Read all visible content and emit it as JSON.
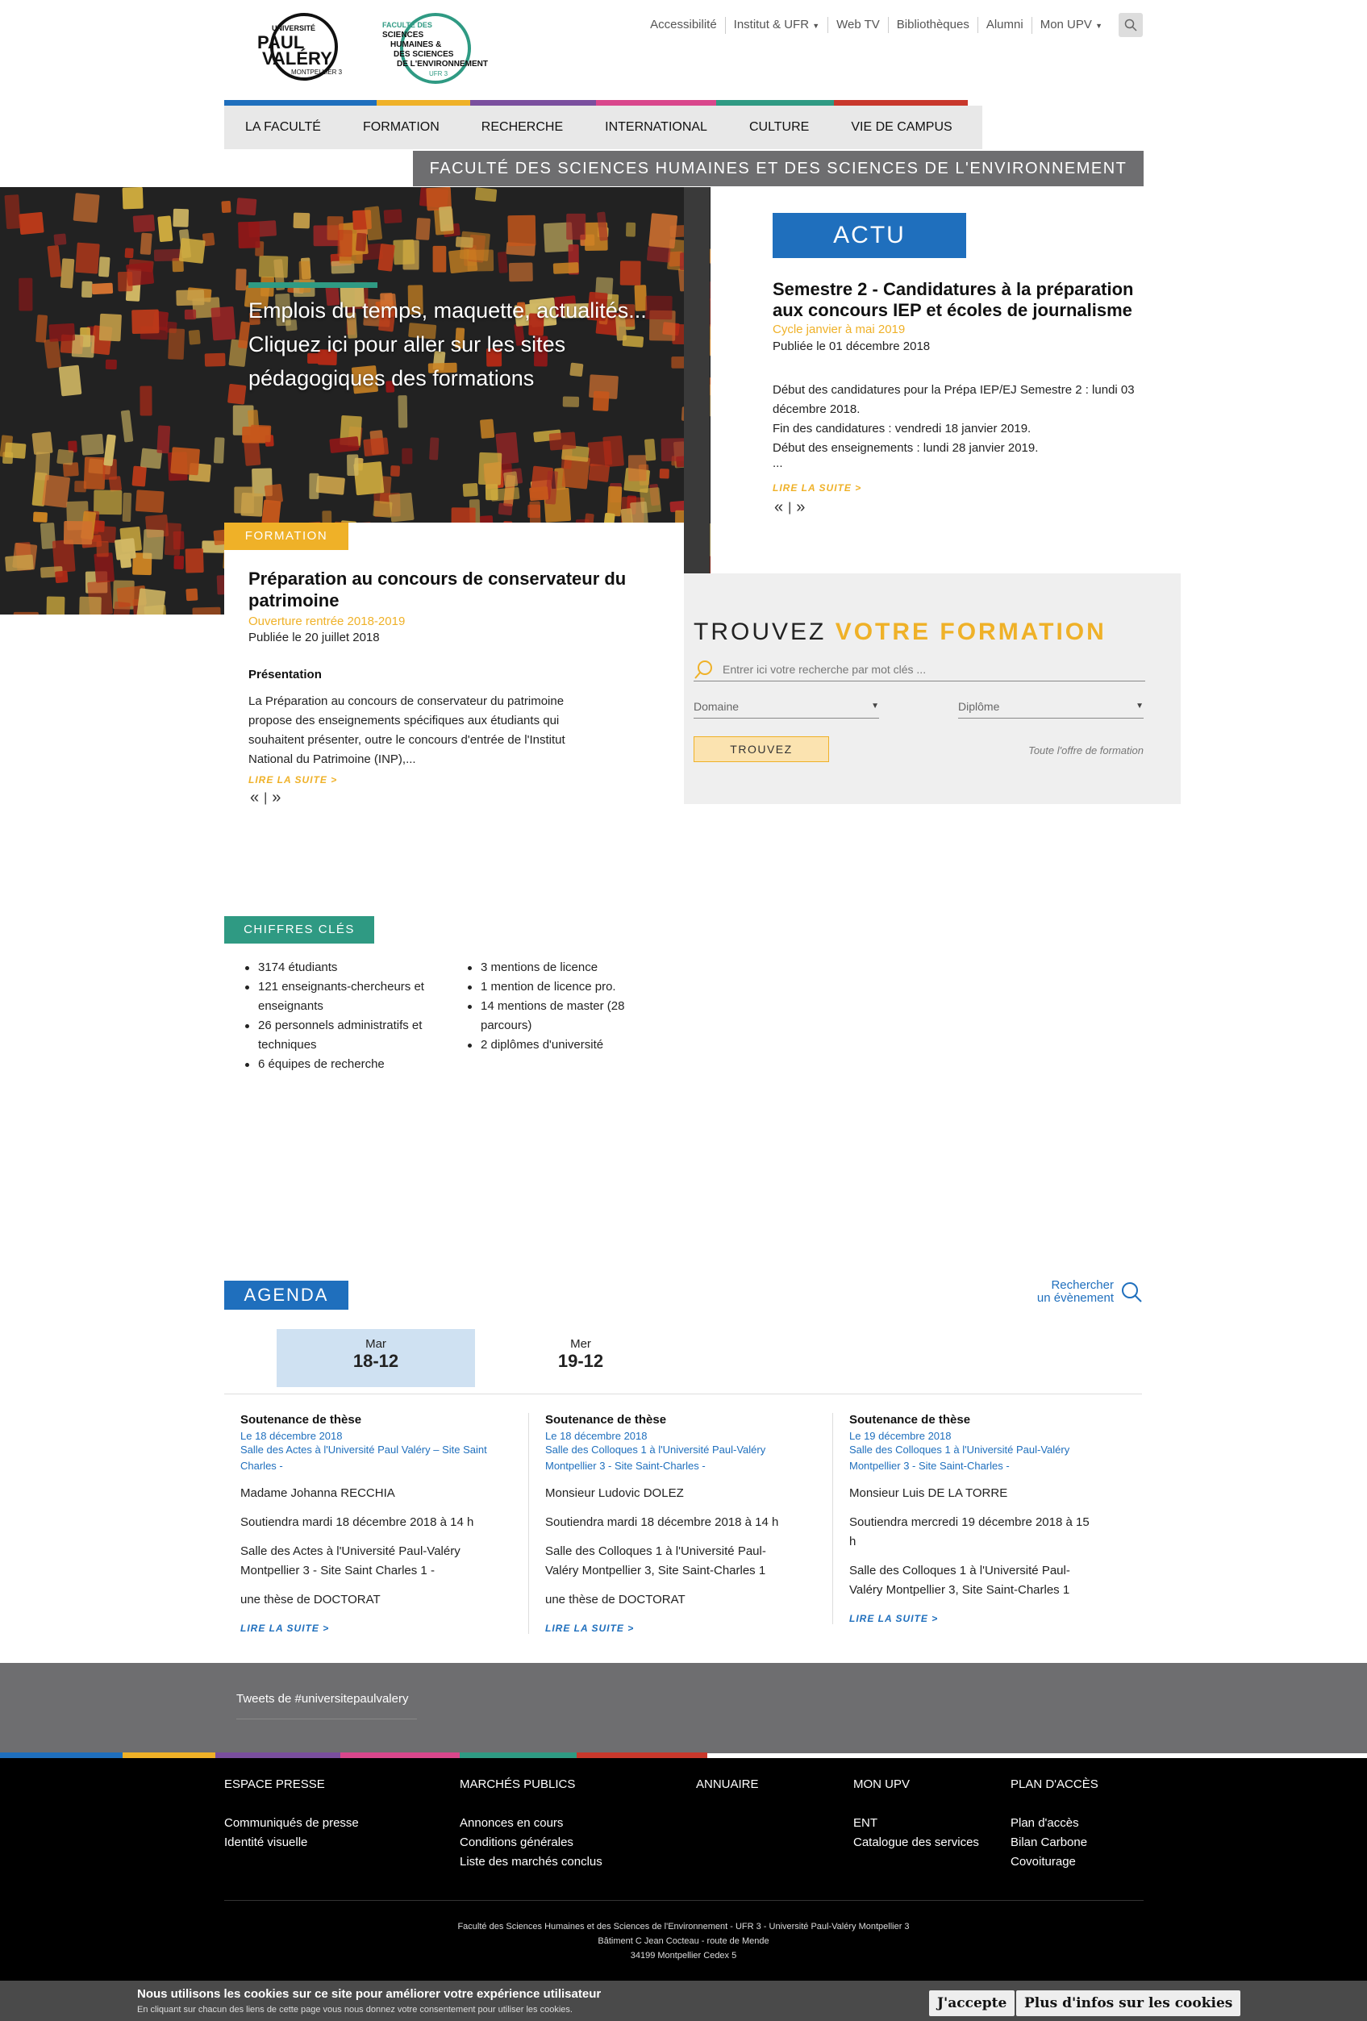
{
  "header": {
    "logo_upv_lines": [
      "UNIVERSITÉ",
      "PAUL",
      "VALÉRY",
      "MONTPELLIER 3"
    ],
    "logo_ufr_lines": [
      "FACULTÉ DES",
      "SCIENCES",
      "HUMAINES &",
      "DES SCIENCES",
      "DE L'ENVIRONNEMENT",
      "UFR 3"
    ],
    "top_links": [
      "Accessibilité",
      "Institut & UFR",
      "Web TV",
      "Bibliothèques",
      "Alumni",
      "Mon UPV"
    ],
    "main_nav": [
      "LA FACULTÉ",
      "FORMATION",
      "RECHERCHE",
      "INTERNATIONAL",
      "CULTURE",
      "VIE DE CAMPUS"
    ],
    "faculty_banner": "FACULTÉ DES SCIENCES HUMAINES ET DES SCIENCES DE L'ENVIRONNEMENT",
    "nav_colors": [
      "#1f6fbd",
      "#efb128",
      "#7a4f9e",
      "#d9478c",
      "#2f9a83",
      "#c8382c"
    ]
  },
  "hero": {
    "text_lines": [
      "Emplois du temps, maquette, actualités...",
      "Cliquez ici pour aller sur les sites",
      "pédagogiques des formations"
    ]
  },
  "formation": {
    "tag": "FORMATION",
    "title": "Préparation au concours de conservateur du patrimoine",
    "subtitle": "Ouverture rentrée 2018-2019",
    "date": "Publiée le 20 juillet 2018",
    "heading": "Présentation",
    "body": "La Préparation au concours de conservateur du patrimoine propose des enseignements spécifiques aux étudiants qui souhaitent présenter, outre le concours d'entrée de l'Institut National du Patrimoine (INP),...",
    "read_more": "LIRE LA SUITE  >"
  },
  "actu": {
    "tag": "ACTU",
    "title": "Semestre 2 - Candidatures à la préparation aux concours IEP et écoles de journalisme",
    "subtitle": "Cycle janvier à mai 2019",
    "date": "Publiée le 01 décembre 2018",
    "body_lines": [
      "Début des candidatures pour la Prépa IEP/EJ Semestre 2 :  lundi 03 décembre 2018.",
      "Fin des candidatures : vendredi 18 janvier 2019.",
      "Début des enseignements : lundi 28 janvier 2019.",
      "..."
    ],
    "read_more": "LIRE LA SUITE  >"
  },
  "pager": {
    "prev": "«",
    "sep": "|",
    "next": "»"
  },
  "trouvez": {
    "title_plain": "TROUVEZ",
    "title_accent": "VOTRE FORMATION",
    "search_placeholder": "Entrer ici votre recherche par mot clés ...",
    "select_domaine": "Domaine",
    "select_diplome": "Diplôme",
    "button": "TROUVEZ",
    "all_link": "Toute l'offre de formation"
  },
  "chiffres": {
    "tag": "CHIFFRES CLÉS",
    "col1": [
      "3174 étudiants",
      "121 enseignants-chercheurs et enseignants",
      "26 personnels administratifs et techniques",
      "6 équipes de recherche"
    ],
    "col2": [
      "3 mentions de licence",
      "1 mention de licence pro.",
      "14 mentions de master (28 parcours)",
      "2 diplômes d'université"
    ]
  },
  "agenda": {
    "tag": "AGENDA",
    "search_line1": "Rechercher",
    "search_line2": "un évènement",
    "days": [
      {
        "name": "Mar",
        "num": "18-12"
      },
      {
        "name": "Mer",
        "num": "19-12"
      }
    ],
    "events": [
      {
        "title": "Soutenance de thèse",
        "date": "Le 18 décembre 2018",
        "place": "Salle des Actes à l'Université Paul Valéry – Site Saint Charles -",
        "p": [
          "Madame Johanna RECCHIA",
          "Soutiendra mardi 18 décembre 2018 à 14 h",
          "Salle des Actes à l'Université Paul-Valéry Montpellier 3  - Site Saint Charles 1 -",
          "une thèse de DOCTORAT"
        ],
        "read_more": "LIRE LA SUITE  >"
      },
      {
        "title": "Soutenance de thèse",
        "date": "Le 18 décembre 2018",
        "place": "Salle des Colloques 1 à l'Université Paul-Valéry Montpellier 3 - Site Saint-Charles -",
        "p": [
          "Monsieur Ludovic DOLEZ",
          "Soutiendra mardi 18 décembre 2018 à 14 h",
          "Salle des Colloques 1 à l'Université Paul-Valéry Montpellier 3, Site Saint-Charles 1",
          "une thèse de DOCTORAT"
        ],
        "read_more": "LIRE LA SUITE  >"
      },
      {
        "title": "Soutenance de thèse",
        "date": "Le 19 décembre 2018",
        "place": "Salle des Colloques 1 à l'Université Paul-Valéry Montpellier 3 - Site Saint-Charles -",
        "p": [
          "Monsieur Luis DE LA TORRE",
          "Soutiendra mercredi 19 décembre 2018 à 15 h",
          "Salle des Colloques 1 à l'Université Paul-Valéry Montpellier 3, Site Saint-Charles 1"
        ],
        "read_more": "LIRE LA SUITE  >"
      }
    ]
  },
  "tweets": {
    "label": "Tweets de #universitepaulvalery"
  },
  "footer": {
    "cols": [
      {
        "heading": "ESPACE PRESSE",
        "links": [
          "Communiqués de presse",
          "Identité visuelle"
        ]
      },
      {
        "heading": "MARCHÉS PUBLICS",
        "links": [
          "Annonces en cours",
          "Conditions générales",
          "Liste des marchés conclus"
        ]
      },
      {
        "heading": "ANNUAIRE",
        "links": []
      },
      {
        "heading": "MON UPV",
        "links": [
          "ENT",
          "Catalogue des services"
        ]
      },
      {
        "heading": "PLAN D'ACCÈS",
        "links": [
          "Plan d'accès",
          "Bilan Carbone",
          "Covoiturage"
        ]
      }
    ],
    "address_lines": [
      "Faculté des Sciences Humaines et des Sciences de l'Environnement - UFR 3 - Université Paul-Valéry Montpellier 3",
      "Bâtiment C Jean Cocteau - route de Mende",
      "34199 Montpellier Cedex 5"
    ]
  },
  "cookie": {
    "title": "Nous utilisons les cookies sur ce site pour améliorer votre expérience utilisateur",
    "subtitle": "En cliquant sur chacun des liens de cette page vous nous donnez votre consentement pour utiliser les cookies.",
    "accept": "J'accepte",
    "more": "Plus d'infos sur les cookies"
  }
}
